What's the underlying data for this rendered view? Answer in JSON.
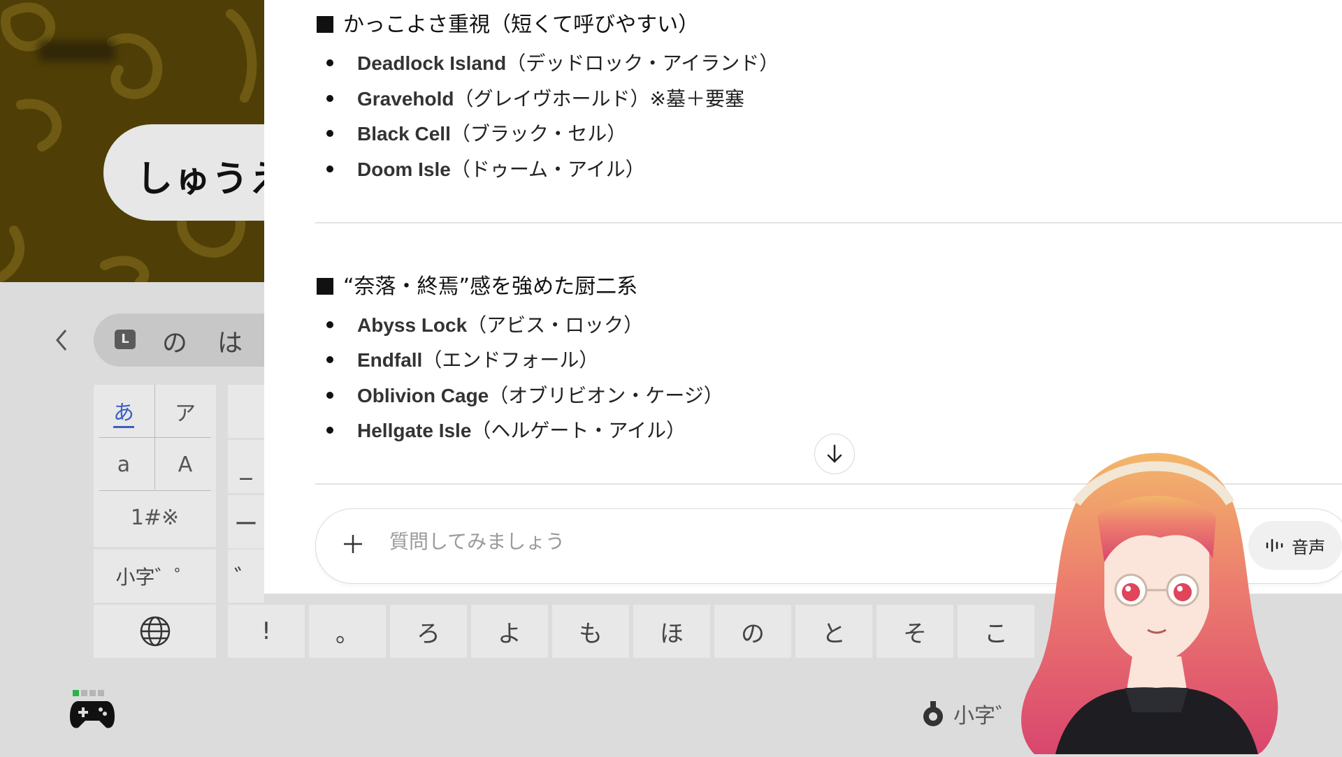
{
  "game": {
    "name_label": "しゅうえ"
  },
  "keyboard": {
    "suggestions": [
      "の",
      "は"
    ],
    "l_badge": "L",
    "modes": {
      "hiragana": "あ",
      "katakana": "ア",
      "lower": "a",
      "upper": "A",
      "symbols": "1#※",
      "small_char": "小字゛゜"
    },
    "row_keys": [
      "!",
      "。",
      "ろ",
      "よ",
      "も",
      "ほ",
      "の",
      "と",
      "そ",
      "こ"
    ],
    "left_col_partial": [
      "",
      "_",
      "ー",
      "゛"
    ],
    "hint_label": "小字゛"
  },
  "chat": {
    "sections": [
      {
        "heading": "かっこよさ重視（短くて呼びやすい）",
        "items": [
          {
            "en": "Deadlock Island",
            "jp": "（デッドロック・アイランド）"
          },
          {
            "en": "Gravehold",
            "jp": "（グレイヴホールド）※墓＋要塞"
          },
          {
            "en": "Black Cell",
            "jp": "（ブラック・セル）"
          },
          {
            "en": "Doom Isle",
            "jp": "（ドゥーム・アイル）"
          }
        ]
      },
      {
        "heading": "“奈落・終焉”感を強めた厨二系",
        "items": [
          {
            "en": "Abyss Lock",
            "jp": "（アビス・ロック）"
          },
          {
            "en": "Endfall",
            "jp": "（エンドフォール）"
          },
          {
            "en": "Oblivion Cage",
            "jp": "（オブリビオン・ケージ）"
          },
          {
            "en": "Hellgate Isle",
            "jp": "（ヘルゲート・アイル）"
          }
        ]
      }
    ],
    "composer": {
      "placeholder": "質問してみましょう",
      "value": "",
      "voice_label": "音声"
    }
  },
  "icons": [
    "back-chevron-icon",
    "globe-icon",
    "controller-icon",
    "scroll-down-arrow-icon",
    "plus-icon",
    "voice-wave-icon"
  ],
  "colors": {
    "game_bg": "#4f3f06",
    "accent_blue": "#1660d6",
    "status_green": "#2bb24c",
    "hira_underline": "#3b5fc7"
  }
}
